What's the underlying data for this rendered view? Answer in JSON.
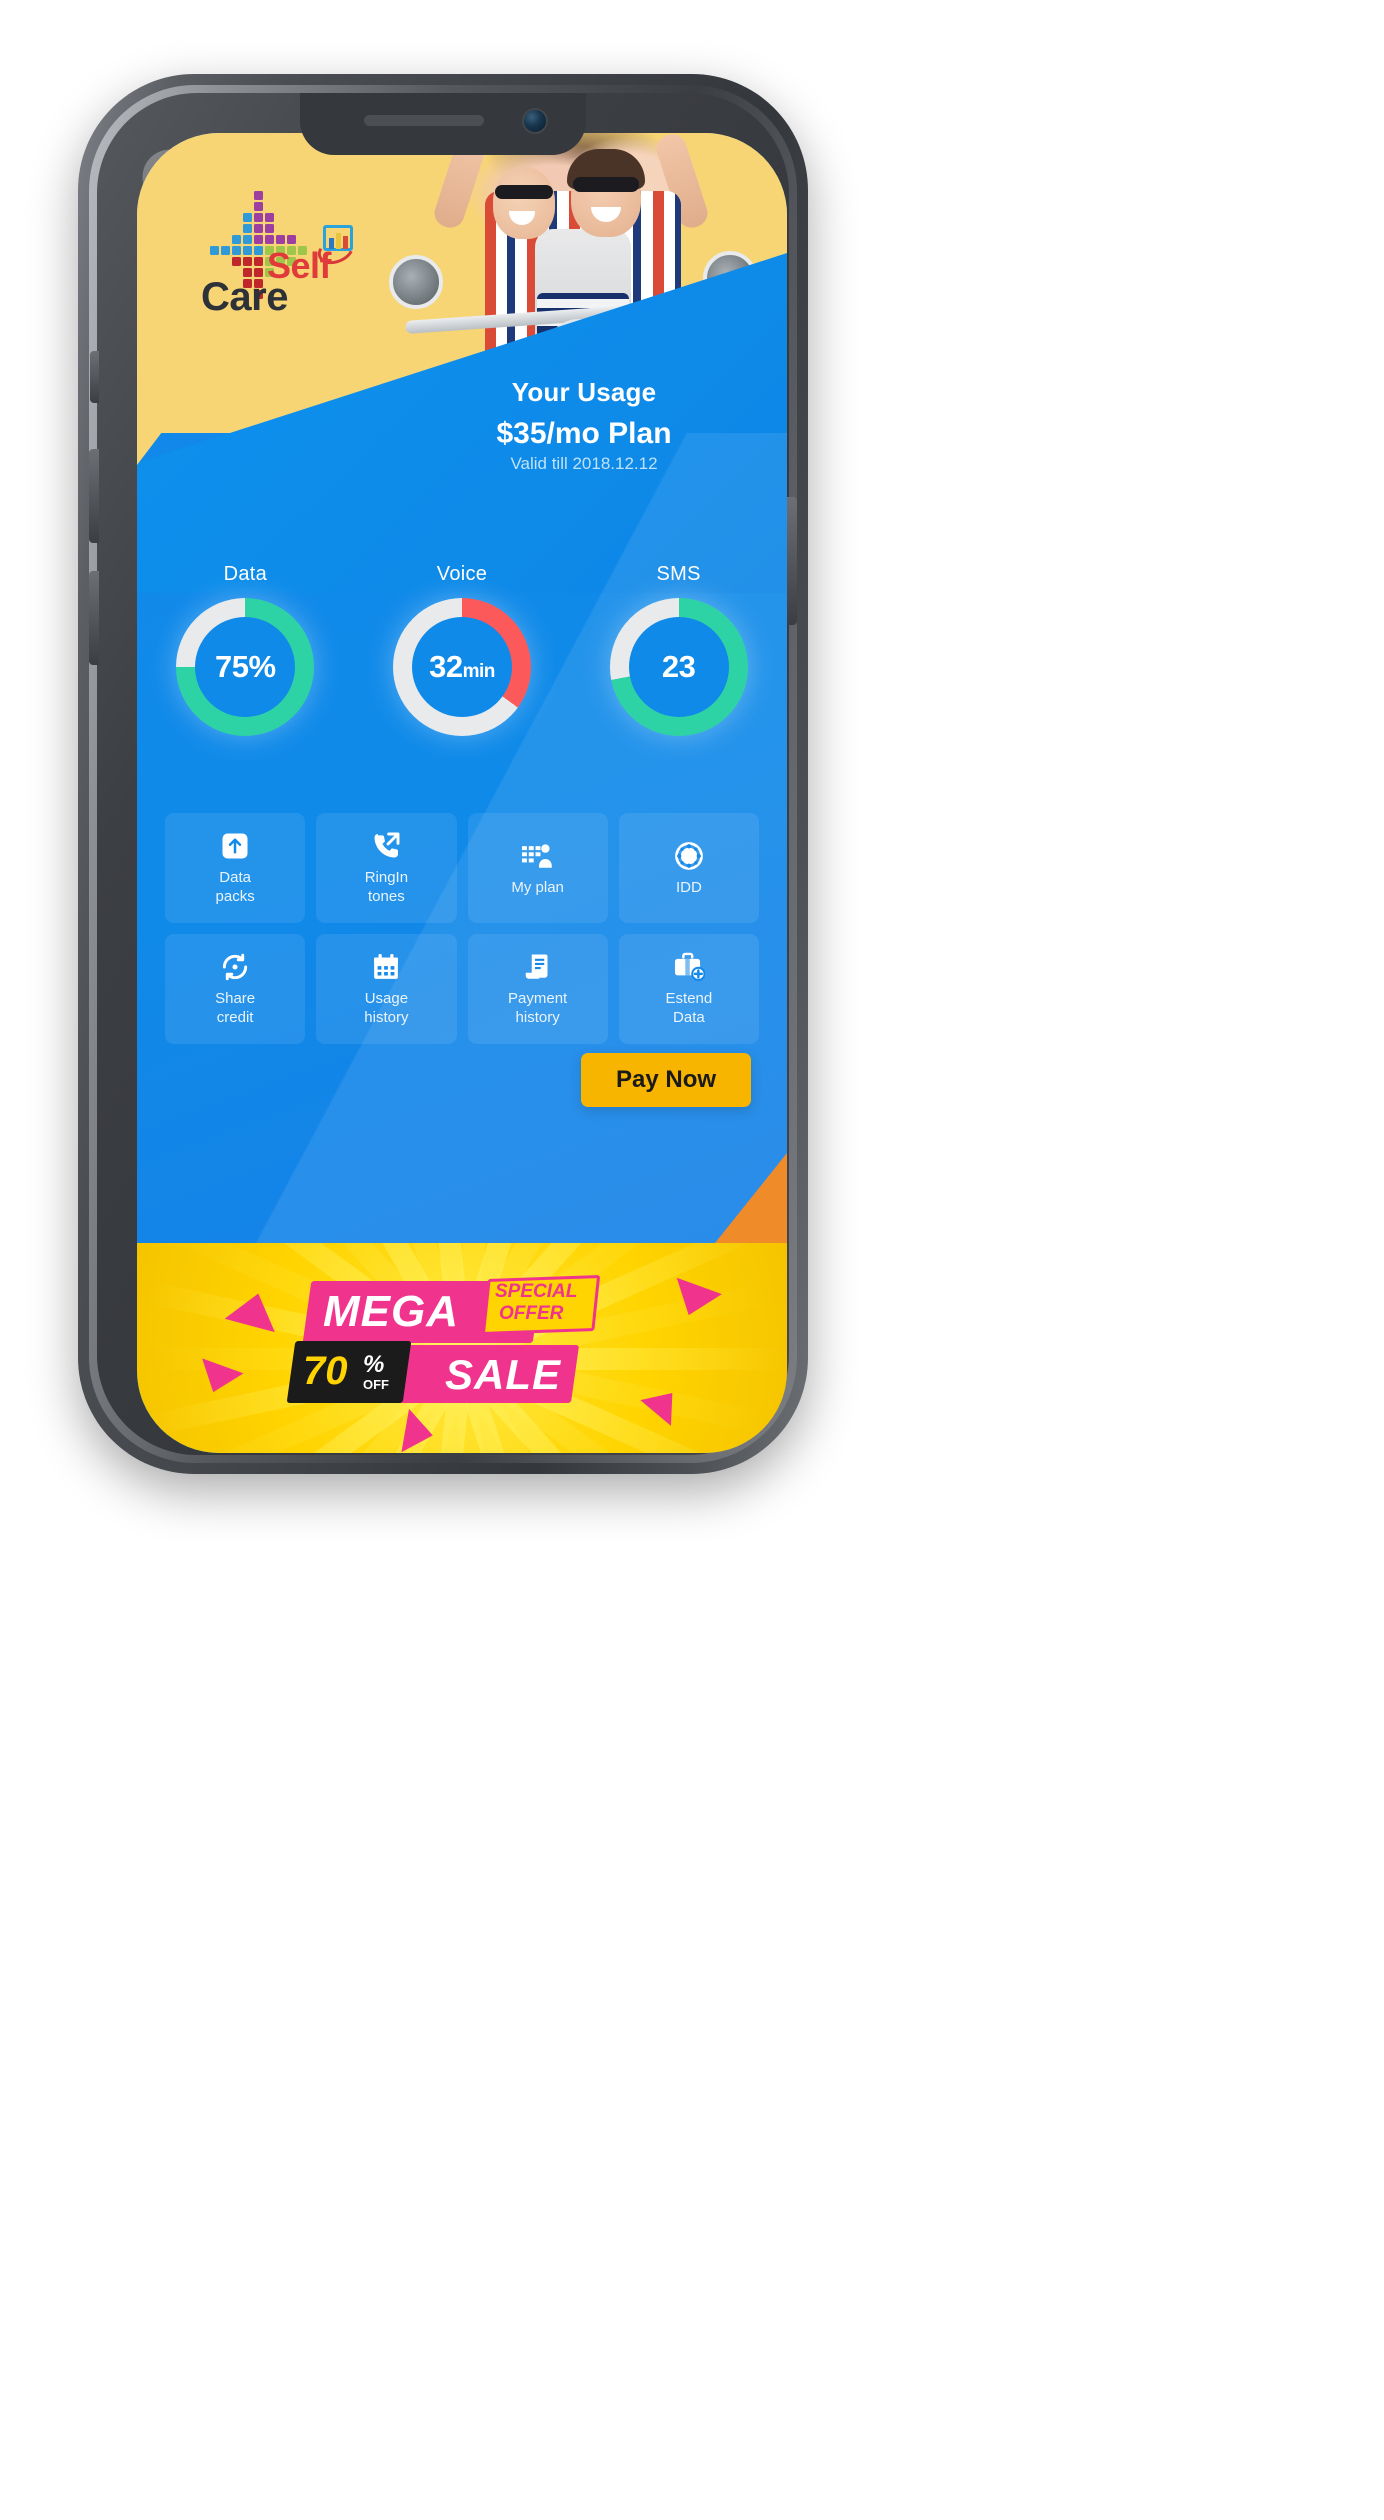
{
  "app": {
    "logo": {
      "self": "Self",
      "care": "Care",
      "mark_icon": "chart-window-icon"
    }
  },
  "usage_header": {
    "title": "Your Usage",
    "plan": "$35/mo Plan",
    "valid": "Valid till 2018.12.12"
  },
  "chart_data": {
    "type": "pie",
    "title": "Your Usage",
    "legend_position": "above-each",
    "charts": [
      {
        "label": "Data",
        "value_text": "75%",
        "value": 75,
        "unit": "",
        "max": 100,
        "used_pct": 75,
        "arc_color": "#2ed3a5",
        "track_color": "#e8eaec"
      },
      {
        "label": "Voice",
        "value_text": "32",
        "value": 32,
        "unit": "min",
        "max": 100,
        "used_pct": 35,
        "arc_color": "#fc5a5a",
        "track_color": "#e8eaec"
      },
      {
        "label": "SMS",
        "value_text": "23",
        "value": 23,
        "unit": "",
        "max": 100,
        "used_pct": 72,
        "arc_color": "#2ed3a5",
        "track_color": "#e8eaec"
      }
    ]
  },
  "tiles": [
    {
      "label": "Data\npacks",
      "icon": "upload-box-icon",
      "line1": "Data",
      "line2": "packs"
    },
    {
      "label": "RingIn\ntones",
      "icon": "phone-outgoing-icon",
      "line1": "RingIn",
      "line2": "tones"
    },
    {
      "label": "My plan",
      "icon": "plan-person-icon",
      "line1": "My plan",
      "line2": ""
    },
    {
      "label": "IDD",
      "icon": "globe-icon",
      "line1": "IDD",
      "line2": ""
    },
    {
      "label": "Share\ncredit",
      "icon": "refresh-share-icon",
      "line1": "Share",
      "line2": "credit"
    },
    {
      "label": "Usage\nhistory",
      "icon": "calendar-icon",
      "line1": "Usage",
      "line2": "history"
    },
    {
      "label": "Payment\nhistory",
      "icon": "receipt-icon",
      "line1": "Payment",
      "line2": "history"
    },
    {
      "label": "Estend\nData",
      "icon": "briefcase-plus-icon",
      "line1": "Estend",
      "line2": "Data"
    }
  ],
  "pay_button": {
    "label": "Pay Now"
  },
  "banner": {
    "mega": "MEGA",
    "special": "SPECIAL",
    "offer": "OFFER",
    "sale": "SALE",
    "discount": "70",
    "percent": "%",
    "off": "OFF"
  },
  "colors": {
    "hero_yellow": "#f7d575",
    "app_blue": "#0f8ae9",
    "accent_yellow": "#f7b500",
    "green": "#2ed3a5",
    "red": "#fc5a5a",
    "banner_yellow": "#ffd400",
    "banner_pink": "#f0338d",
    "orange": "#f08b2a"
  }
}
